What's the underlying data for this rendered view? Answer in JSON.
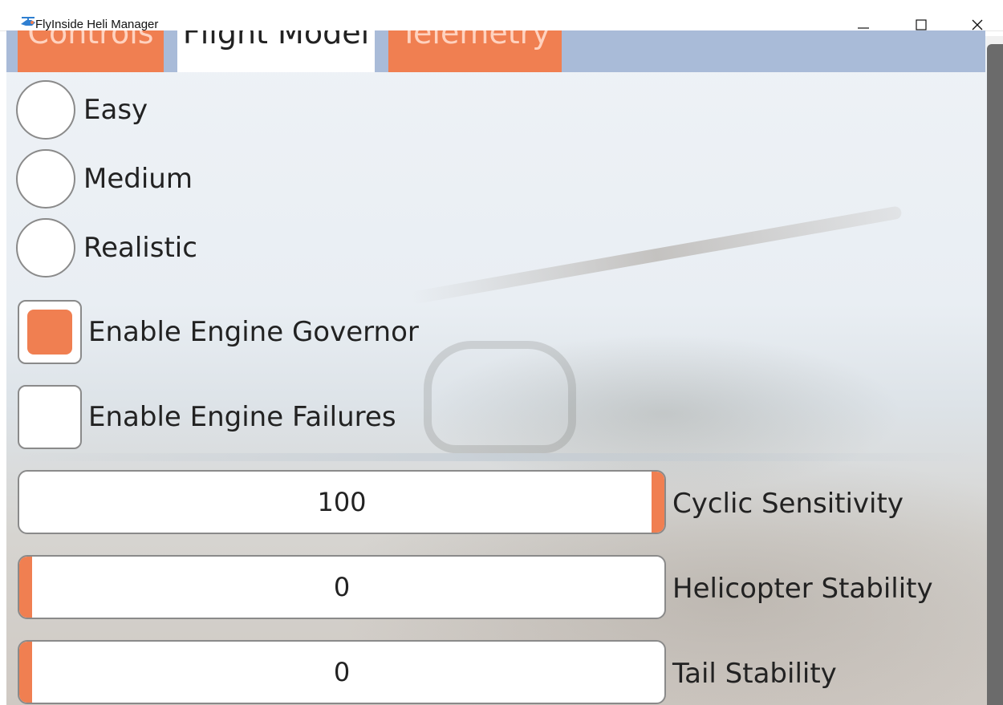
{
  "window": {
    "title": "FlyInside Heli Manager"
  },
  "tabs": [
    {
      "label": "Controls",
      "active": false
    },
    {
      "label": "Flight Model",
      "active": true
    },
    {
      "label": "Telemetry",
      "active": false
    }
  ],
  "difficulty": {
    "options": [
      {
        "label": "Easy",
        "selected": false
      },
      {
        "label": "Medium",
        "selected": false
      },
      {
        "label": "Realistic",
        "selected": false
      }
    ]
  },
  "checkboxes": [
    {
      "label": "Enable Engine Governor",
      "checked": true
    },
    {
      "label": "Enable Engine Failures",
      "checked": false
    }
  ],
  "sliders": [
    {
      "label": "Cyclic Sensitivity",
      "value": "100",
      "fraction": 1.0
    },
    {
      "label": "Helicopter Stability",
      "value": "0",
      "fraction": 0.0
    },
    {
      "label": "Tail Stability",
      "value": "0",
      "fraction": 0.0
    }
  ],
  "colors": {
    "accent": "#f07f51",
    "tab_bar": "#a9bbd8",
    "inactive_tab_text": "#ffd2bf"
  },
  "icons": {
    "app": "helicopter-icon",
    "minimize": "minimize-icon",
    "maximize": "maximize-icon",
    "close": "close-icon"
  }
}
